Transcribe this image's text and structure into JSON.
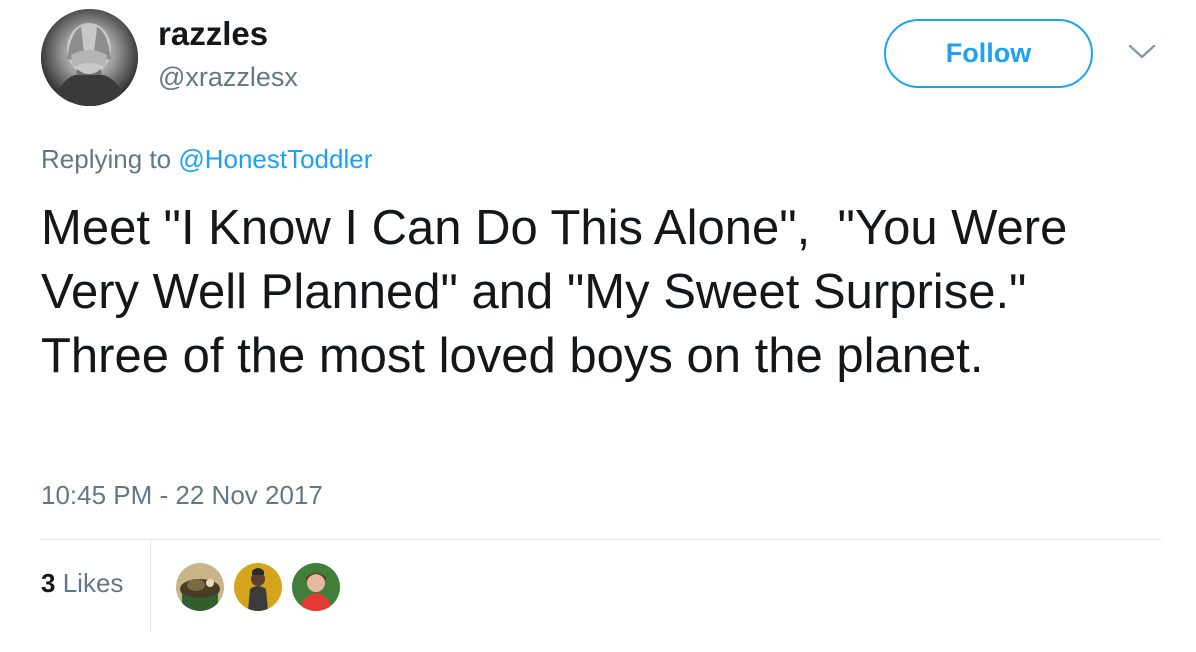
{
  "user": {
    "display_name": "razzles",
    "handle": "@xrazzlesx",
    "avatar_icon": "weeping-angel-avatar"
  },
  "follow_button": {
    "label": "Follow",
    "color": "#1da1f2"
  },
  "menu": {
    "icon": "chevron-down-icon"
  },
  "reply": {
    "prefix": "Replying to",
    "mention": "@HonestToddler"
  },
  "tweet": {
    "text": "Meet \"I Know I Can Do This Alone\",  \"You Were Very Well Planned\" and \"My Sweet Surprise.\"  Three of the most loved boys on the planet."
  },
  "meta": {
    "timestamp": "10:45 PM - 22 Nov 2017"
  },
  "stats": {
    "likes_count": "3",
    "likes_label": "Likes"
  },
  "likers": [
    {
      "icon": "liker-avatar-1",
      "color": "#6b5a3e"
    },
    {
      "icon": "liker-avatar-2",
      "color": "#d4a51c"
    },
    {
      "icon": "liker-avatar-3",
      "color": "#2e7d32"
    }
  ],
  "colors": {
    "accent": "#1da1f2",
    "secondary_text": "#657786",
    "primary_text": "#14171a",
    "divider": "#e1e8ed"
  }
}
